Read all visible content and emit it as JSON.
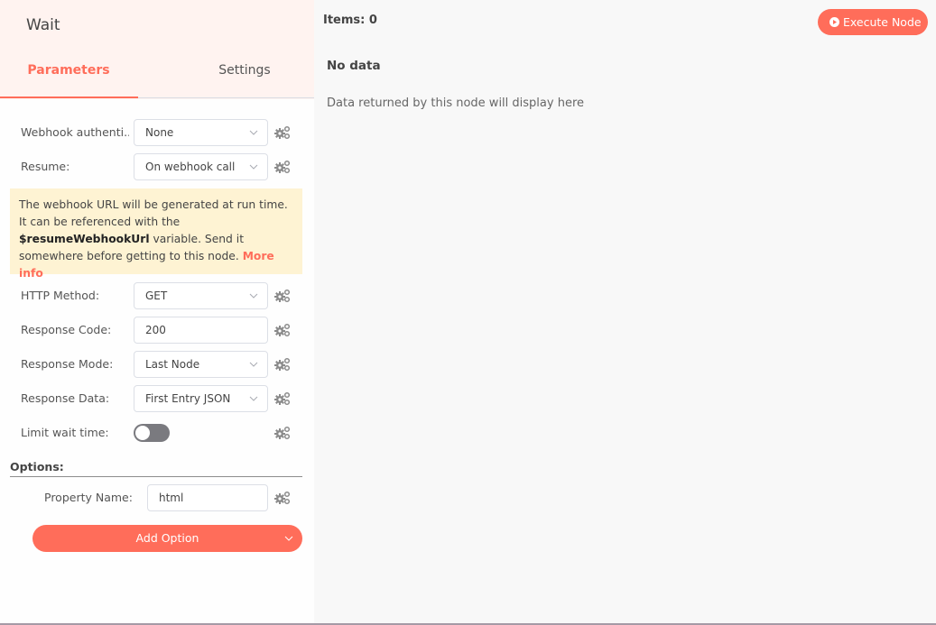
{
  "node": {
    "title": "Wait"
  },
  "tabs": [
    {
      "label": "Parameters",
      "active": true
    },
    {
      "label": "Settings",
      "active": false
    }
  ],
  "parameters": {
    "webhook_auth": {
      "label": "Webhook authenti...",
      "value": "None",
      "type": "select"
    },
    "resume": {
      "label": "Resume:",
      "value": "On webhook call",
      "type": "select"
    },
    "notice": {
      "text_before": "The webhook URL will be generated at run time. It can be referenced with the ",
      "variable": "$resumeWebhookUrl",
      "text_after": " variable. Send it somewhere before getting to this node. ",
      "link": "More info"
    },
    "http_method": {
      "label": "HTTP Method:",
      "value": "GET",
      "type": "select"
    },
    "response_code": {
      "label": "Response Code:",
      "value": "200",
      "type": "input"
    },
    "response_mode": {
      "label": "Response Mode:",
      "value": "Last Node",
      "type": "select"
    },
    "response_data": {
      "label": "Response Data:",
      "value": "First Entry JSON",
      "type": "select"
    },
    "limit_wait_time": {
      "label": "Limit wait time:",
      "value": false,
      "type": "toggle"
    }
  },
  "options": {
    "label": "Options:",
    "property_name": {
      "label": "Property Name:",
      "value": "html"
    },
    "add_option_label": "Add Option"
  },
  "output": {
    "items_label": "Items: 0",
    "execute_label": "Execute Node",
    "no_data_title": "No data",
    "no_data_text": "Data returned by this node will display here"
  },
  "colors": {
    "accent": "#ff6d5a",
    "header_bg": "#fff3f0",
    "notice_bg": "#fef3d3",
    "toggle_off": "#7a7a7f"
  },
  "icons": {
    "gear": "gear-cogs-icon",
    "chevron": "chevron-down-icon",
    "play": "play-circle-icon"
  }
}
